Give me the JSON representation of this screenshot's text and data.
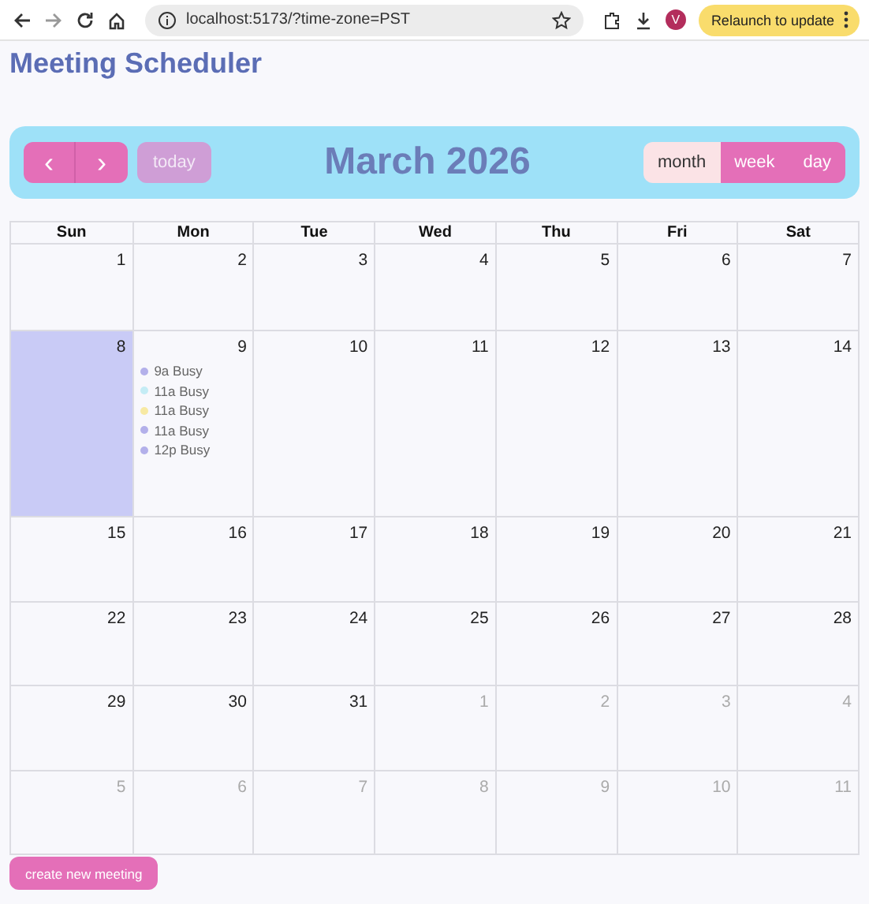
{
  "browser": {
    "url": "localhost:5173/?time-zone=PST",
    "profile_initial": "V",
    "relaunch_label": "Relaunch to update"
  },
  "title": "Meeting Scheduler",
  "toolbar": {
    "prev": "‹",
    "next": "›",
    "today": {
      "label": "today",
      "disabled": true
    },
    "title": "March 2026",
    "views": [
      {
        "label": "month",
        "selected": true
      },
      {
        "label": "week",
        "selected": false
      },
      {
        "label": "day",
        "selected": false
      }
    ]
  },
  "calendar": {
    "weekdays": [
      "Sun",
      "Mon",
      "Tue",
      "Wed",
      "Thu",
      "Fri",
      "Sat"
    ],
    "weeks": [
      {
        "days": [
          {
            "number": "1",
            "outside": false,
            "today": false
          },
          {
            "number": "2",
            "outside": false,
            "today": false
          },
          {
            "number": "3",
            "outside": false,
            "today": false
          },
          {
            "number": "4",
            "outside": false,
            "today": false
          },
          {
            "number": "5",
            "outside": false,
            "today": false
          },
          {
            "number": "6",
            "outside": false,
            "today": false
          },
          {
            "number": "7",
            "outside": false,
            "today": false
          }
        ]
      },
      {
        "days": [
          {
            "number": "8",
            "outside": false,
            "today": true
          },
          {
            "number": "9",
            "outside": false,
            "today": false,
            "events": [
              {
                "label": "9a Busy",
                "color": "#b3b0ea"
              },
              {
                "label": "11a Busy",
                "color": "#c4ecf5"
              },
              {
                "label": "11a Busy",
                "color": "#f7e9a3"
              },
              {
                "label": "11a Busy",
                "color": "#b3b0ea"
              },
              {
                "label": "12p Busy",
                "color": "#b3b0ea"
              }
            ]
          },
          {
            "number": "10",
            "outside": false,
            "today": false
          },
          {
            "number": "11",
            "outside": false,
            "today": false
          },
          {
            "number": "12",
            "outside": false,
            "today": false
          },
          {
            "number": "13",
            "outside": false,
            "today": false
          },
          {
            "number": "14",
            "outside": false,
            "today": false
          }
        ]
      },
      {
        "days": [
          {
            "number": "15",
            "outside": false,
            "today": false
          },
          {
            "number": "16",
            "outside": false,
            "today": false
          },
          {
            "number": "17",
            "outside": false,
            "today": false
          },
          {
            "number": "18",
            "outside": false,
            "today": false
          },
          {
            "number": "19",
            "outside": false,
            "today": false
          },
          {
            "number": "20",
            "outside": false,
            "today": false
          },
          {
            "number": "21",
            "outside": false,
            "today": false
          }
        ]
      },
      {
        "days": [
          {
            "number": "22",
            "outside": false,
            "today": false
          },
          {
            "number": "23",
            "outside": false,
            "today": false
          },
          {
            "number": "24",
            "outside": false,
            "today": false
          },
          {
            "number": "25",
            "outside": false,
            "today": false
          },
          {
            "number": "26",
            "outside": false,
            "today": false
          },
          {
            "number": "27",
            "outside": false,
            "today": false
          },
          {
            "number": "28",
            "outside": false,
            "today": false
          }
        ]
      },
      {
        "days": [
          {
            "number": "29",
            "outside": false,
            "today": false
          },
          {
            "number": "30",
            "outside": false,
            "today": false
          },
          {
            "number": "31",
            "outside": false,
            "today": false
          },
          {
            "number": "1",
            "outside": true,
            "today": false
          },
          {
            "number": "2",
            "outside": true,
            "today": false
          },
          {
            "number": "3",
            "outside": true,
            "today": false
          },
          {
            "number": "4",
            "outside": true,
            "today": false
          }
        ]
      },
      {
        "days": [
          {
            "number": "5",
            "outside": true,
            "today": false
          },
          {
            "number": "6",
            "outside": true,
            "today": false
          },
          {
            "number": "7",
            "outside": true,
            "today": false
          },
          {
            "number": "8",
            "outside": true,
            "today": false
          },
          {
            "number": "9",
            "outside": true,
            "today": false
          },
          {
            "number": "10",
            "outside": true,
            "today": false
          },
          {
            "number": "11",
            "outside": true,
            "today": false
          }
        ]
      }
    ]
  },
  "create_button": "create new meeting"
}
